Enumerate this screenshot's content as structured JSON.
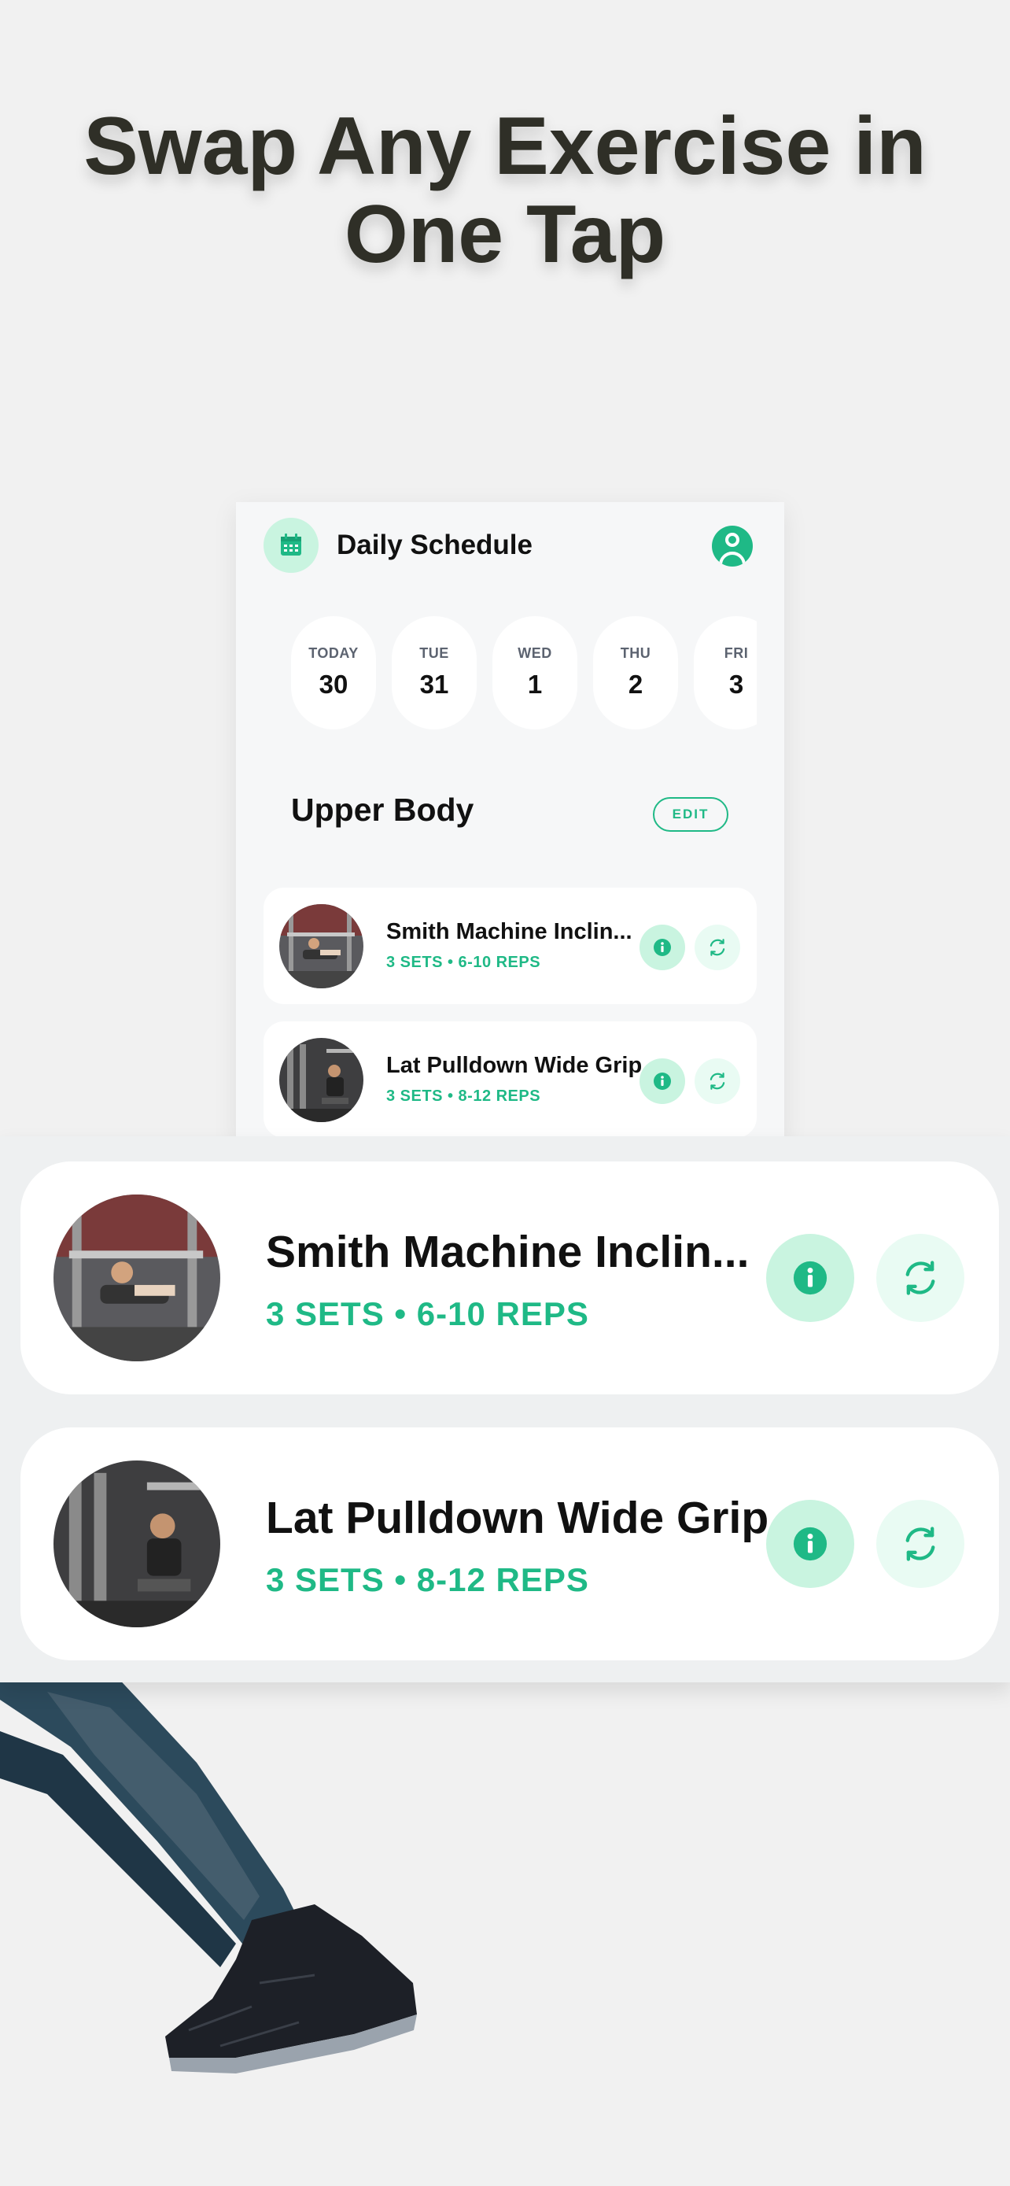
{
  "headline": {
    "line1": "Swap Any Exercise in",
    "line2": "One Tap"
  },
  "app": {
    "title": "Daily Schedule",
    "icons": {
      "calendar": "calendar-icon",
      "profile": "user-profile-icon",
      "info": "info-icon",
      "swap": "swap-icon"
    },
    "days": [
      {
        "name": "TODAY",
        "date": "30"
      },
      {
        "name": "TUE",
        "date": "31"
      },
      {
        "name": "WED",
        "date": "1"
      },
      {
        "name": "THU",
        "date": "2"
      },
      {
        "name": "FRI",
        "date": "3"
      }
    ],
    "section_title": "Upper Body",
    "edit_label": "EDIT",
    "exercises": [
      {
        "name": "Smith Machine Inclin...",
        "meta": "3 SETS • 6-10 REPS"
      },
      {
        "name": "Lat Pulldown Wide Grip",
        "meta": "3 SETS • 8-12 REPS"
      }
    ]
  },
  "colors": {
    "accent": "#1fb986",
    "accent_light": "#c9f4e0",
    "accent_lighter": "#e9fbf3",
    "headline": "#2f2f27",
    "background": "#f1f1f1"
  }
}
